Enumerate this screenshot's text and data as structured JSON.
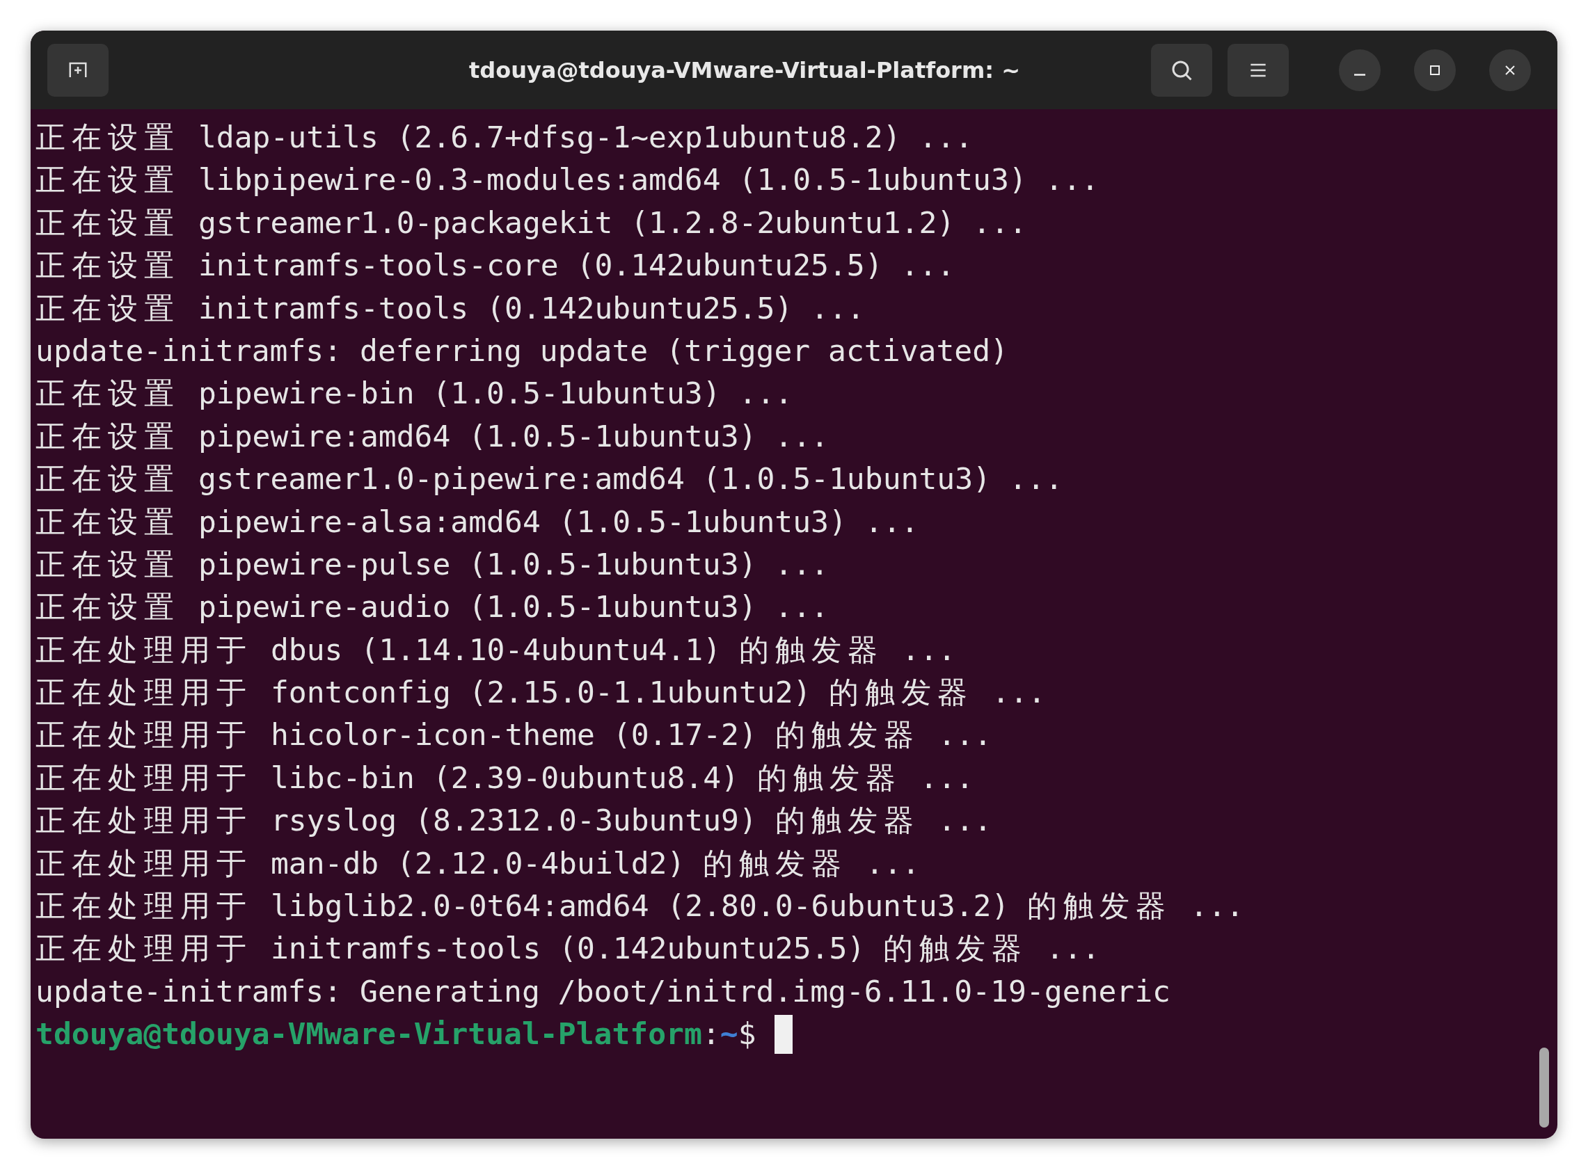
{
  "window": {
    "title": "tdouya@tdouya-VMware-Virtual-Platform: ~"
  },
  "terminal": {
    "lines": [
      "正在设置 ldap-utils (2.6.7+dfsg-1~exp1ubuntu8.2) ...",
      "正在设置 libpipewire-0.3-modules:amd64 (1.0.5-1ubuntu3) ...",
      "正在设置 gstreamer1.0-packagekit (1.2.8-2ubuntu1.2) ...",
      "正在设置 initramfs-tools-core (0.142ubuntu25.5) ...",
      "正在设置 initramfs-tools (0.142ubuntu25.5) ...",
      "update-initramfs: deferring update (trigger activated)",
      "正在设置 pipewire-bin (1.0.5-1ubuntu3) ...",
      "正在设置 pipewire:amd64 (1.0.5-1ubuntu3) ...",
      "正在设置 gstreamer1.0-pipewire:amd64 (1.0.5-1ubuntu3) ...",
      "正在设置 pipewire-alsa:amd64 (1.0.5-1ubuntu3) ...",
      "正在设置 pipewire-pulse (1.0.5-1ubuntu3) ...",
      "正在设置 pipewire-audio (1.0.5-1ubuntu3) ...",
      "正在处理用于 dbus (1.14.10-4ubuntu4.1) 的触发器 ...",
      "正在处理用于 fontconfig (2.15.0-1.1ubuntu2) 的触发器 ...",
      "正在处理用于 hicolor-icon-theme (0.17-2) 的触发器 ...",
      "正在处理用于 libc-bin (2.39-0ubuntu8.4) 的触发器 ...",
      "正在处理用于 rsyslog (8.2312.0-3ubuntu9) 的触发器 ...",
      "正在处理用于 man-db (2.12.0-4build2) 的触发器 ...",
      "正在处理用于 libglib2.0-0t64:amd64 (2.80.0-6ubuntu3.2) 的触发器 ...",
      "正在处理用于 initramfs-tools (0.142ubuntu25.5) 的触发器 ...",
      "update-initramfs: Generating /boot/initrd.img-6.11.0-19-generic"
    ],
    "prompt": {
      "user_host": "tdouya@tdouya-VMware-Virtual-Platform",
      "separator": ":",
      "path": "~",
      "symbol": "$"
    }
  }
}
